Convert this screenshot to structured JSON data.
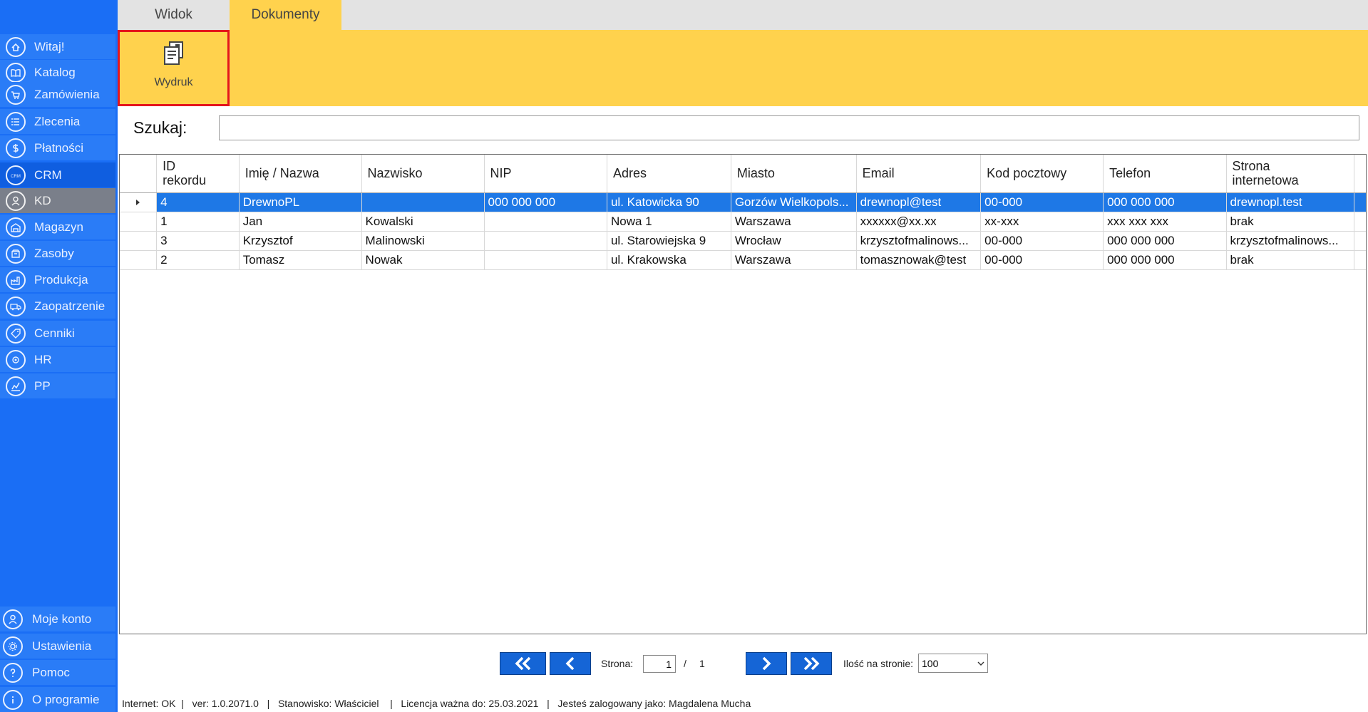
{
  "tabs": [
    {
      "label": "Widok"
    },
    {
      "label": "Dokumenty"
    }
  ],
  "ribbon": {
    "print_label": "Wydruk"
  },
  "sidebar": {
    "items": [
      {
        "label": "Witaj!",
        "icon": "home-icon"
      },
      {
        "label": "Katalog",
        "icon": "book-icon"
      },
      {
        "label": "Zamówienia",
        "icon": "cart-icon"
      },
      {
        "label": "Zlecenia",
        "icon": "list-icon"
      },
      {
        "label": "Płatności",
        "icon": "dollar-icon"
      },
      {
        "label": "CRM",
        "icon": "crm-icon"
      },
      {
        "label": "KD",
        "icon": "user-icon"
      },
      {
        "label": "Magazyn",
        "icon": "warehouse-icon"
      },
      {
        "label": "Zasoby",
        "icon": "box-icon"
      },
      {
        "label": "Produkcja",
        "icon": "factory-icon"
      },
      {
        "label": "Zaopatrzenie",
        "icon": "truck-icon"
      },
      {
        "label": "Cenniki",
        "icon": "tag-icon"
      },
      {
        "label": "HR",
        "icon": "badge-icon"
      },
      {
        "label": "PP",
        "icon": "chart-icon"
      }
    ],
    "bottom_items": [
      {
        "label": "Moje konto",
        "icon": "account-icon"
      },
      {
        "label": "Ustawienia",
        "icon": "gear-icon"
      },
      {
        "label": "Pomoc",
        "icon": "help-icon"
      },
      {
        "label": "O programie",
        "icon": "info-icon"
      }
    ]
  },
  "search": {
    "label": "Szukaj:",
    "value": ""
  },
  "grid": {
    "columns": [
      {
        "label": "ID\nrekordu"
      },
      {
        "label": "Imię / Nazwa"
      },
      {
        "label": "Nazwisko"
      },
      {
        "label": "NIP"
      },
      {
        "label": "Adres"
      },
      {
        "label": "Miasto"
      },
      {
        "label": "Email"
      },
      {
        "label": "Kod pocztowy"
      },
      {
        "label": "Telefon"
      },
      {
        "label": "Strona\ninternetowa"
      }
    ],
    "rows": [
      {
        "cells": [
          "4",
          "DrewnoPL",
          "",
          "000 000 000",
          "ul. Katowicka 90",
          "Gorzów Wielkopols...",
          "drewnopl@test",
          "00-000",
          "000 000 000",
          "drewnopl.test"
        ],
        "selected": true
      },
      {
        "cells": [
          "1",
          "Jan",
          "Kowalski",
          "",
          "Nowa 1",
          "Warszawa",
          "xxxxxx@xx.xx",
          "xx-xxx",
          "xxx xxx xxx",
          "brak"
        ],
        "selected": false
      },
      {
        "cells": [
          "3",
          "Krzysztof",
          "Malinowski",
          "",
          "ul. Starowiejska 9",
          "Wrocław",
          "krzysztofmalinows...",
          "00-000",
          "000 000 000",
          "krzysztofmalinows..."
        ],
        "selected": false
      },
      {
        "cells": [
          "2",
          "Tomasz",
          "Nowak",
          "",
          "ul. Krakowska",
          "Warszawa",
          "tomasznowak@test",
          "00-000",
          "000 000 000",
          "brak"
        ],
        "selected": false
      }
    ]
  },
  "pager": {
    "page_label": "Strona:",
    "current_page": "1",
    "separator": "/",
    "total_pages": "1",
    "page_size_label": "Ilość na stronie:",
    "page_size": "100"
  },
  "status": "Internet: OK  |   ver: 1.0.2071.0   |   Stanowisko: Właściciel    |   Licencja ważna do: 25.03.2021   |   Jesteś zalogowany jako: Magdalena Mucha",
  "colors": {
    "sidebar": "#1a6ef5",
    "ribbon": "#ffd24d",
    "selection": "#1e78e6",
    "pager": "#1565d6",
    "highlight_border": "#e4161d"
  }
}
